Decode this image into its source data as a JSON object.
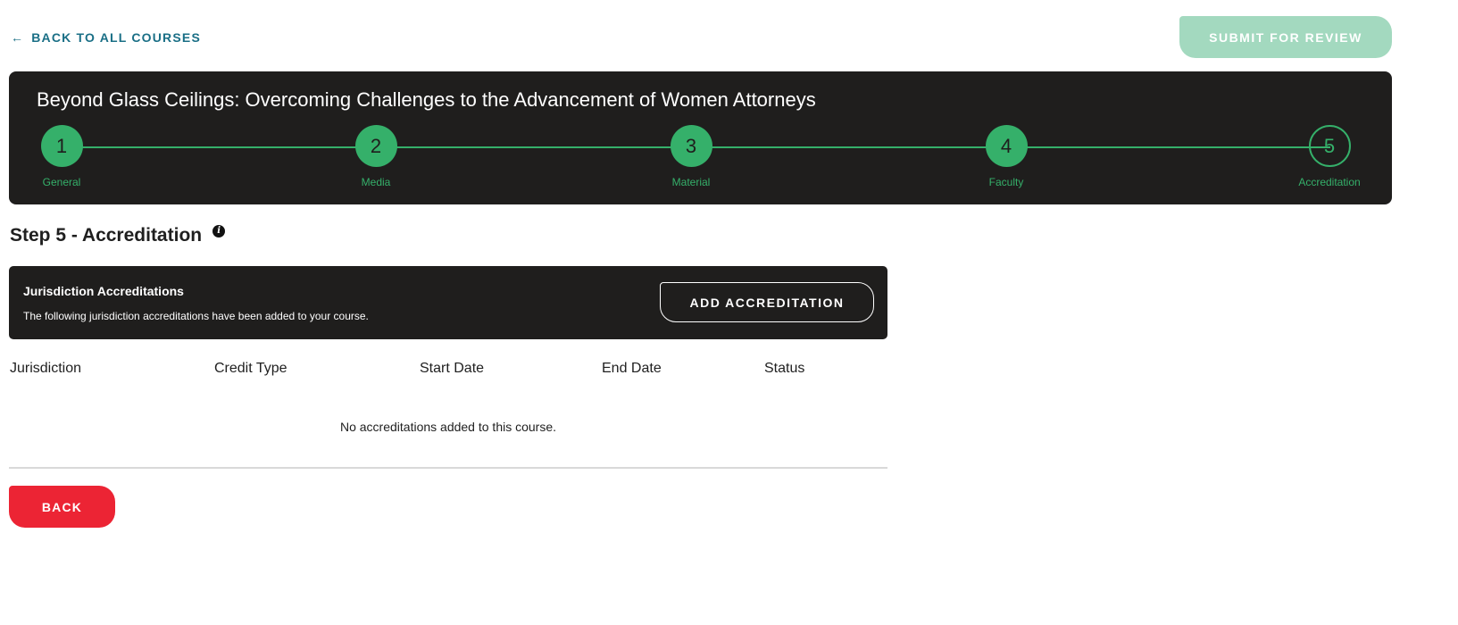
{
  "top": {
    "back_link_label": "BACK TO ALL COURSES",
    "submit_label": "SUBMIT FOR REVIEW"
  },
  "course": {
    "title": "Beyond Glass Ceilings: Overcoming Challenges to the Advancement of Women Attorneys"
  },
  "steps": [
    {
      "number": "1",
      "label": "General",
      "state": "complete"
    },
    {
      "number": "2",
      "label": "Media",
      "state": "complete"
    },
    {
      "number": "3",
      "label": "Material",
      "state": "complete"
    },
    {
      "number": "4",
      "label": "Faculty",
      "state": "complete"
    },
    {
      "number": "5",
      "label": "Accreditation",
      "state": "current"
    }
  ],
  "section": {
    "heading": "Step 5 - Accreditation",
    "info_icon_glyph": "i"
  },
  "accreditations": {
    "title": "Jurisdiction Accreditations",
    "description": "The following jurisdiction accreditations have been added to your course.",
    "add_label": "ADD ACCREDITATION"
  },
  "table": {
    "columns": [
      "Jurisdiction",
      "Credit Type",
      "Start Date",
      "End Date",
      "Status"
    ],
    "empty_message": "No accreditations added to this course."
  },
  "footer": {
    "back_label": "BACK"
  },
  "colors": {
    "accent_green": "#35b06a",
    "submit_disabled": "#a3d9bf",
    "back_red": "#ec2434",
    "link_teal": "#1a6f86",
    "panel_dark": "#1f1e1d"
  }
}
